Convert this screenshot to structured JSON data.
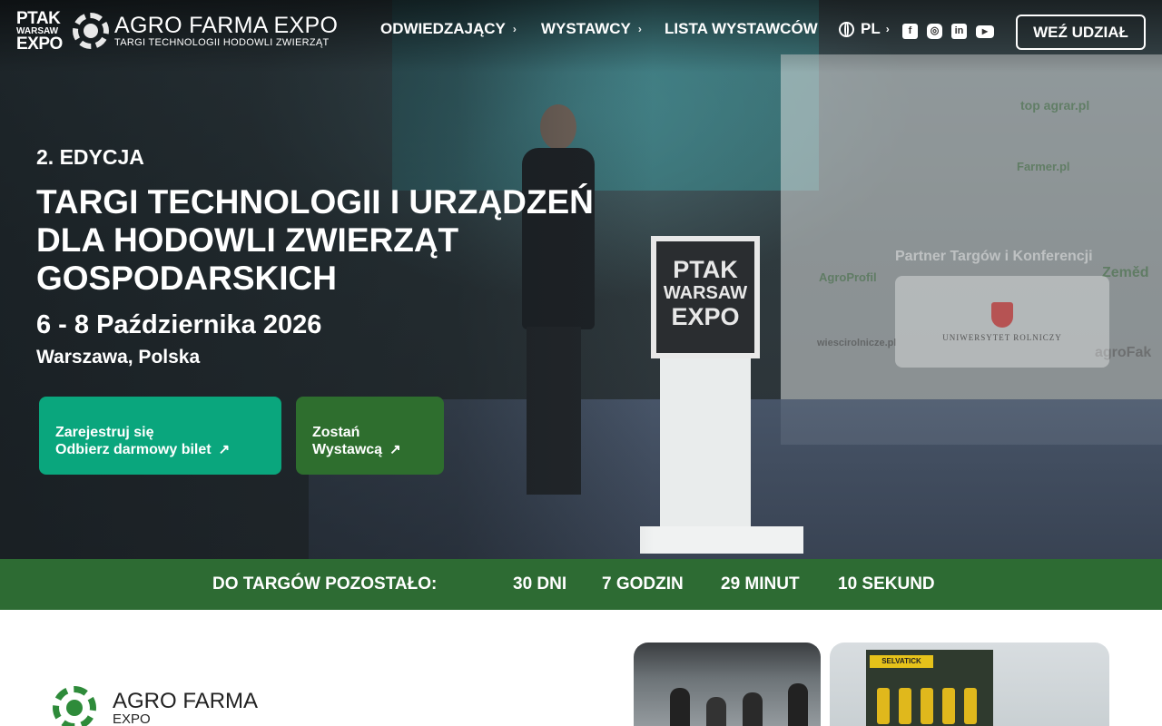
{
  "header": {
    "ptak_logo": [
      "PTAK",
      "WARSAW",
      "EXPO"
    ],
    "agro_title": "AGRO FARMA EXPO",
    "agro_subtitle": "TARGI TECHNOLOGII HODOWLI ZWIERZĄT",
    "nav": [
      {
        "label": "ODWIEDZAJĄCY",
        "has_chevron": true
      },
      {
        "label": "WYSTAWCY",
        "has_chevron": true
      },
      {
        "label": "LISTA WYSTAWCÓW",
        "has_chevron": false
      }
    ],
    "language": "PL",
    "social_icons": [
      "facebook-icon",
      "instagram-icon",
      "linkedin-icon",
      "youtube-icon"
    ],
    "cta": "WEŹ UDZIAŁ"
  },
  "hero": {
    "edition": "2. EDYCJA",
    "title_lines": [
      "TARGI TECHNOLOGII I URZĄDZEŃ",
      "DLA HODOWLI ZWIERZĄT",
      "GOSPODARSKICH"
    ],
    "dates": "6 - 8 Października 2026",
    "place": "Warszawa, Polska",
    "btn_register": [
      "Zarejestruj się",
      "Odbierz darmowy bilet"
    ],
    "btn_exhibitor": [
      "Zostań",
      "Wystawcą"
    ],
    "partner_label": "Partner Targów i Konferencji",
    "partner_name": "UNIWERSYTET ROLNICZY",
    "podium_logo": [
      "PTAK",
      "WARSAW",
      "EXPO"
    ]
  },
  "countdown": {
    "label": "DO TARGÓW POZOSTAŁO:",
    "days": "30 DNI",
    "hours": "7 GODZIN",
    "minutes": "29 MINUT",
    "seconds": "10 SEKUND"
  },
  "lower": {
    "logo_line1": "AGRO FARMA",
    "logo_line2": "EXPO",
    "photo_banner": "SELVATICK"
  },
  "colors": {
    "register_green": "#0aa67d",
    "exhibitor_green": "#2e6e2e",
    "countdown_green": "#2d6b33"
  }
}
